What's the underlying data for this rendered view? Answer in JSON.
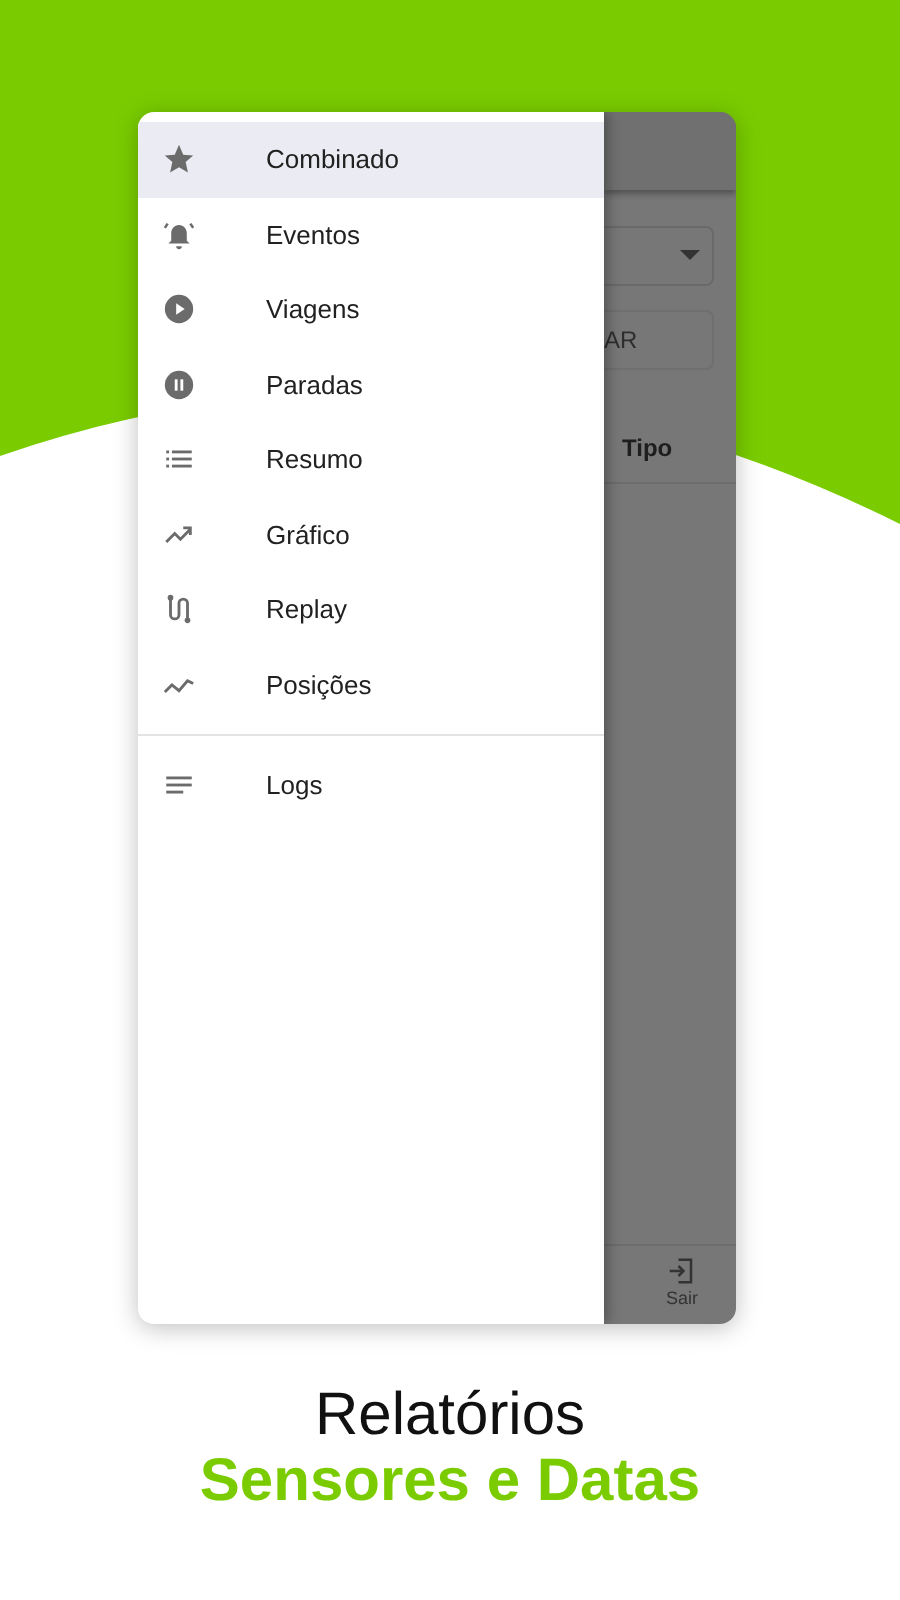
{
  "drawer": {
    "items": [
      {
        "label": "Combinado",
        "selected": true
      },
      {
        "label": "Eventos",
        "selected": false
      },
      {
        "label": "Viagens",
        "selected": false
      },
      {
        "label": "Paradas",
        "selected": false
      },
      {
        "label": "Resumo",
        "selected": false
      },
      {
        "label": "Gráfico",
        "selected": false
      },
      {
        "label": "Replay",
        "selected": false
      },
      {
        "label": "Posições",
        "selected": false
      }
    ],
    "secondary_items": [
      {
        "label": "Logs",
        "selected": false
      }
    ]
  },
  "background_screen": {
    "button_text": "AR",
    "column_header": "Tipo",
    "bottom_nav": [
      {
        "label": "Sair"
      }
    ]
  },
  "caption": {
    "title": "Relatórios",
    "subtitle": "Sensores e Datas"
  }
}
